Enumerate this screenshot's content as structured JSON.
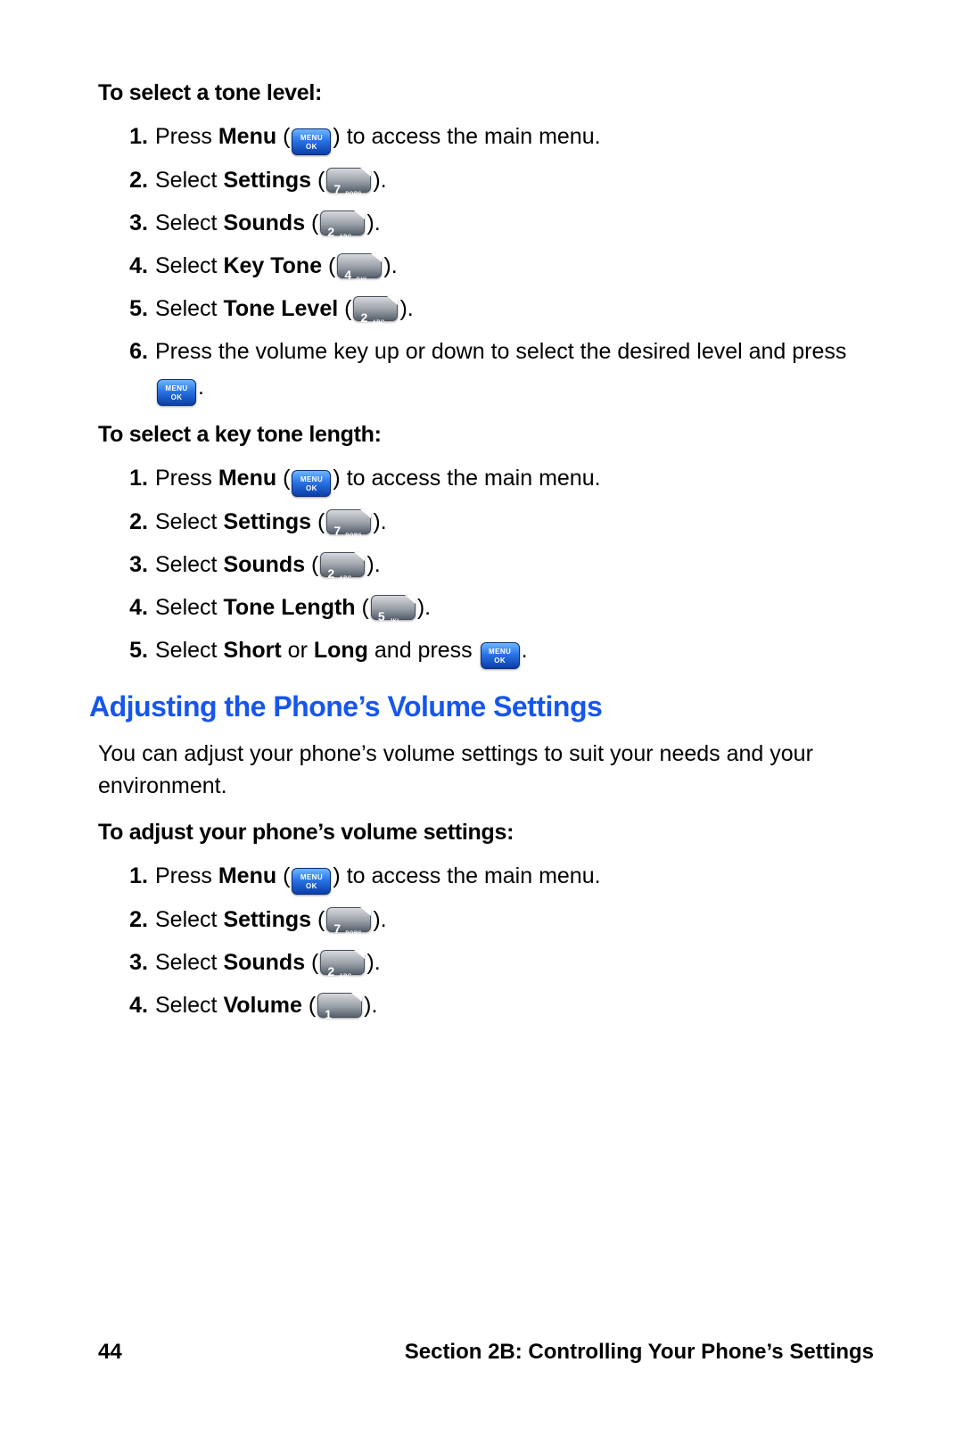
{
  "sections": {
    "toneLevel": {
      "title": "To select a tone level:",
      "items": [
        {
          "n": "1.",
          "pre": "Press ",
          "bold": "Menu",
          "post": " to access the main menu.",
          "key": "menu",
          "wrap": true
        },
        {
          "n": "2.",
          "pre": "Select ",
          "bold": "Settings",
          "post": ".",
          "key": "7",
          "wrap": true
        },
        {
          "n": "3.",
          "pre": "Select ",
          "bold": "Sounds",
          "post": ".",
          "key": "2",
          "wrap": true
        },
        {
          "n": "4.",
          "pre": "Select ",
          "bold": "Key Tone",
          "post": ".",
          "key": "4",
          "wrap": true
        },
        {
          "n": "5.",
          "pre": "Select ",
          "bold": "Tone Level",
          "post": ".",
          "key": "2",
          "wrap": true
        },
        {
          "n": "6.",
          "pre": "Press the volume key up or down to select the desired level and press ",
          "bold": "",
          "post": ".",
          "key": "menu",
          "wrap": false
        }
      ]
    },
    "toneLength": {
      "title": "To select a key tone length:",
      "items": [
        {
          "n": "1.",
          "pre": "Press ",
          "bold": "Menu",
          "post": " to access the main menu.",
          "key": "menu",
          "wrap": true
        },
        {
          "n": "2.",
          "pre": "Select ",
          "bold": "Settings",
          "post": ".",
          "key": "7",
          "wrap": true
        },
        {
          "n": "3.",
          "pre": "Select ",
          "bold": "Sounds",
          "post": ".",
          "key": "2",
          "wrap": true
        },
        {
          "n": "4.",
          "pre": "Select ",
          "bold": "Tone Length",
          "post": ".",
          "key": "5",
          "wrap": true
        },
        {
          "n": "5.",
          "pre": "Select ",
          "bold": "Short",
          "mid": " or ",
          "bold2": "Long",
          "post2": " and press ",
          "post": ".",
          "key": "menu",
          "wrap": false
        }
      ]
    },
    "volume": {
      "heading": "Adjusting the Phone’s Volume Settings",
      "intro": "You can adjust your phone’s volume settings to suit your needs and your environment.",
      "title": "To adjust your phone’s volume settings:",
      "items": [
        {
          "n": "1.",
          "pre": "Press ",
          "bold": "Menu",
          "post": " to access the main menu.",
          "key": "menu",
          "wrap": true
        },
        {
          "n": "2.",
          "pre": "Select ",
          "bold": "Settings",
          "post": ".",
          "key": "7",
          "wrap": true
        },
        {
          "n": "3.",
          "pre": "Select ",
          "bold": "Sounds",
          "post": ".",
          "key": "2",
          "wrap": true
        },
        {
          "n": "4.",
          "pre": "Select ",
          "bold": "Volume",
          "post": ".",
          "key": "1",
          "wrap": true
        }
      ]
    }
  },
  "keys": {
    "1": {
      "d": "1",
      "l": ""
    },
    "2": {
      "d": "2",
      "l": "ABC"
    },
    "4": {
      "d": "4",
      "l": "GHI"
    },
    "5": {
      "d": "5",
      "l": "JKL"
    },
    "7": {
      "d": "7",
      "l": "PQRS"
    }
  },
  "footer": {
    "page": "44",
    "text": "Section 2B: Controlling Your Phone’s Settings"
  }
}
